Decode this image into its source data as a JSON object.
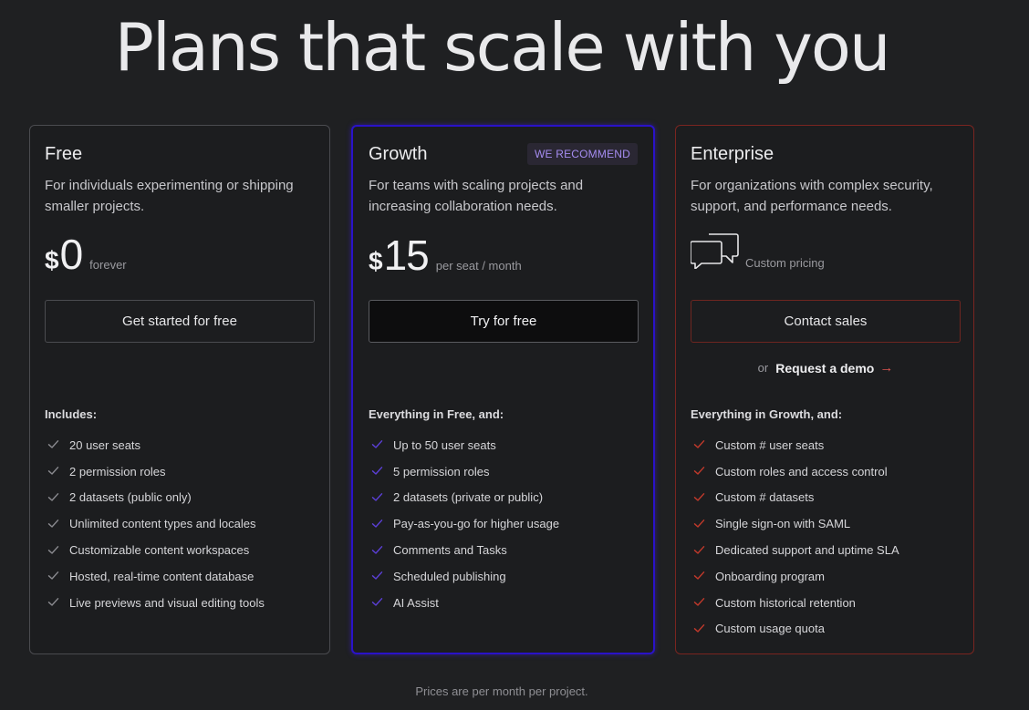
{
  "hero": {
    "title": "Plans that scale with you"
  },
  "plans": {
    "free": {
      "name": "Free",
      "description": "For individuals experimenting or shipping smaller projects.",
      "currency": "$",
      "amount": "0",
      "price_note": "forever",
      "cta_label": "Get started for free",
      "features_title": "Includes:",
      "check_color": "#8a8a8f",
      "features": [
        "20 user seats",
        "2 permission roles",
        "2 datasets (public only)",
        "Unlimited content types and locales",
        "Customizable content workspaces",
        "Hosted, real-time content database",
        "Live previews and visual editing tools"
      ]
    },
    "growth": {
      "name": "Growth",
      "badge": "WE RECOMMEND",
      "description": "For teams with scaling projects and increasing collaboration needs.",
      "currency": "$",
      "amount": "15",
      "price_note": "per seat / month",
      "cta_label": "Try for free",
      "features_title": "Everything in Free, and:",
      "check_color": "#5b3fd6",
      "accent_color": "#2a12c9",
      "features": [
        "Up to 50 user seats",
        "5 permission roles",
        "2 datasets (private or public)",
        "Pay-as-you-go for higher usage",
        "Comments and Tasks",
        "Scheduled publishing",
        "AI Assist"
      ]
    },
    "enterprise": {
      "name": "Enterprise",
      "description": "For organizations with complex security, support, and performance needs.",
      "icon": "chat-bubbles-icon",
      "price_note": "Custom pricing",
      "cta_label": "Contact sales",
      "demo_or": "or",
      "demo_label": "Request a demo",
      "demo_arrow": "→",
      "features_title": "Everything in Growth, and:",
      "check_color": "#c0392b",
      "accent_color": "#7a2520",
      "features": [
        "Custom # user seats",
        "Custom roles and access control",
        "Custom # datasets",
        "Single sign-on with SAML",
        "Dedicated support and uptime SLA",
        "Onboarding program",
        "Custom historical retention",
        "Custom usage quota"
      ]
    }
  },
  "footnote": "Prices are per month per project."
}
